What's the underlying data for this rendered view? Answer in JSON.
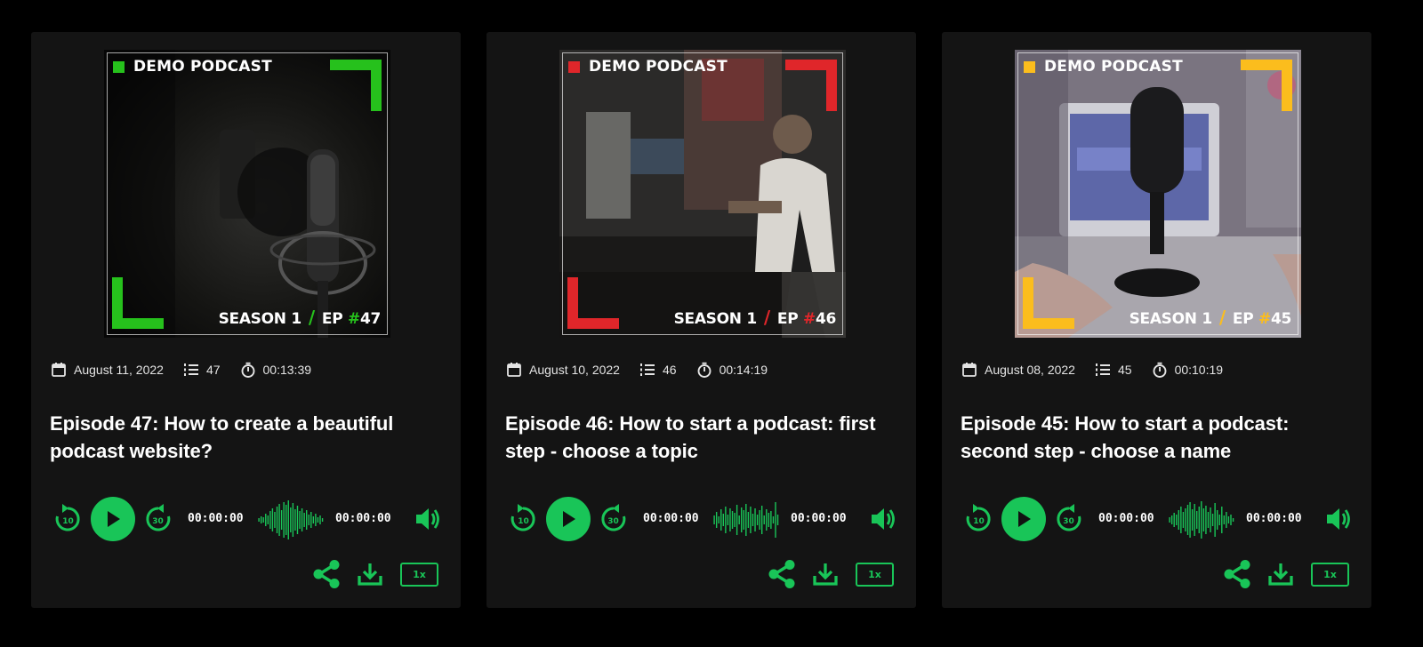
{
  "colors": {
    "background": "#000000",
    "card": "#141414",
    "player_accent": "#19c558"
  },
  "icons": {
    "date": "calendar-icon",
    "episode": "numbered-list-icon",
    "duration": "stopwatch-icon",
    "rewind": "rewind-10-icon",
    "play": "play-icon",
    "forward": "forward-30-icon",
    "volume": "volume-icon",
    "share": "share-icon",
    "download": "download-icon"
  },
  "episodes": [
    {
      "brand": "DEMO PODCAST",
      "accent": "#26c11c",
      "season_label": "SEASON 1",
      "ep_label": "EP",
      "ep_hash": "#",
      "ep_number": "47",
      "date": "August 11, 2022",
      "number": "47",
      "duration": "00:13:39",
      "title": "Episode 47: How to create a beautiful podcast website?",
      "rewind_label": "10",
      "forward_label": "30",
      "current_time": "00:00:00",
      "total_time": "00:00:00",
      "speed": "1x"
    },
    {
      "brand": "DEMO PODCAST",
      "accent": "#e0262a",
      "season_label": "SEASON 1",
      "ep_label": "EP",
      "ep_hash": "#",
      "ep_number": "46",
      "date": "August 10, 2022",
      "number": "46",
      "duration": "00:14:19",
      "title": "Episode 46: How to start a podcast: first step - choose a topic",
      "rewind_label": "10",
      "forward_label": "30",
      "current_time": "00:00:00",
      "total_time": "00:00:00",
      "speed": "1x"
    },
    {
      "brand": "DEMO PODCAST",
      "accent": "#fbbd1d",
      "season_label": "SEASON 1",
      "ep_label": "EP",
      "ep_hash": "#",
      "ep_number": "45",
      "date": "August 08, 2022",
      "number": "45",
      "duration": "00:10:19",
      "title": "Episode 45: How to start a podcast: second step - choose a name",
      "rewind_label": "10",
      "forward_label": "30",
      "current_time": "00:00:00",
      "total_time": "00:00:00",
      "speed": "1x"
    }
  ]
}
